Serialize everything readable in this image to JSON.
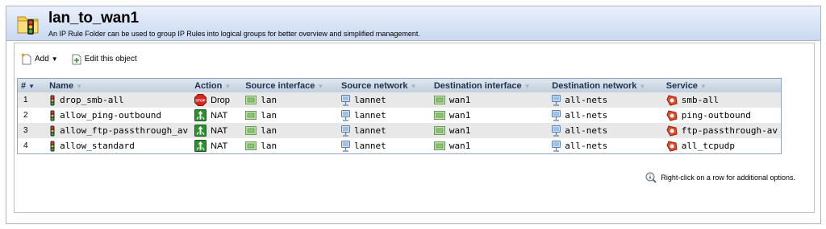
{
  "header": {
    "title": "lan_to_wan1",
    "description": "An IP Rule Folder can be used to group IP Rules into logical groups for better overview and simplified management."
  },
  "toolbar": {
    "add_label": "Add",
    "edit_label": "Edit this object"
  },
  "table": {
    "columns": [
      "#",
      "Name",
      "Action",
      "Source interface",
      "Source network",
      "Destination interface",
      "Destination network",
      "Service"
    ],
    "rows": [
      {
        "num": "1",
        "name": "drop_smb-all",
        "action": "Drop",
        "action_icon": "stop-icon",
        "src_if": "lan",
        "src_net": "lannet",
        "dst_if": "wan1",
        "dst_net": "all-nets",
        "service": "smb-all"
      },
      {
        "num": "2",
        "name": "allow_ping-outbound",
        "action": "NAT",
        "action_icon": "nat-icon",
        "src_if": "lan",
        "src_net": "lannet",
        "dst_if": "wan1",
        "dst_net": "all-nets",
        "service": "ping-outbound"
      },
      {
        "num": "3",
        "name": "allow_ftp-passthrough_av",
        "action": "NAT",
        "action_icon": "nat-icon",
        "src_if": "lan",
        "src_net": "lannet",
        "dst_if": "wan1",
        "dst_net": "all-nets",
        "service": "ftp-passthrough-av"
      },
      {
        "num": "4",
        "name": "allow_standard",
        "action": "NAT",
        "action_icon": "nat-icon",
        "src_if": "lan",
        "src_net": "lannet",
        "dst_if": "wan1",
        "dst_net": "all-nets",
        "service": "all_tcpudp"
      }
    ]
  },
  "hint": "Right-click on a row for additional options."
}
